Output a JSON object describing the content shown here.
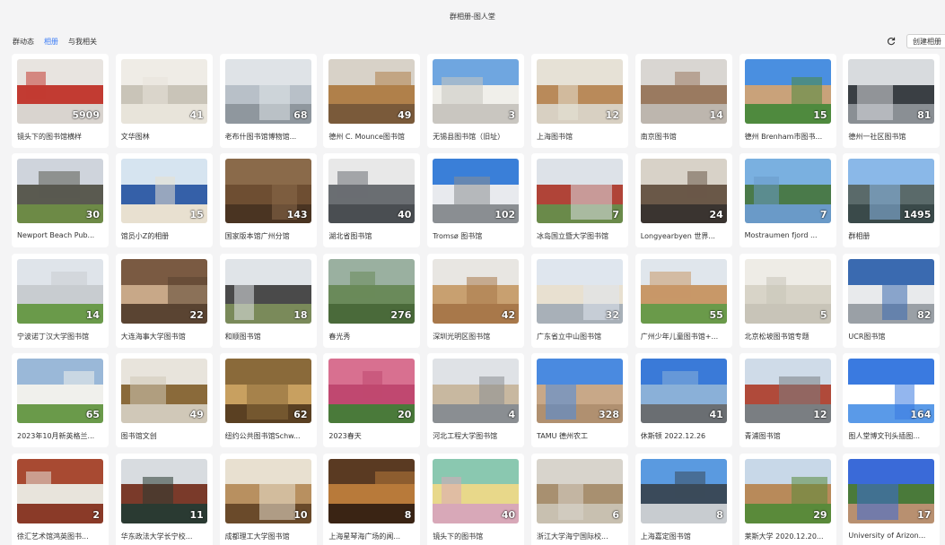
{
  "window": {
    "title": "群相册-图人堂"
  },
  "nav": {
    "tabs": [
      {
        "label": "群动态",
        "active": false
      },
      {
        "label": "相册",
        "active": true
      },
      {
        "label": "与我相关",
        "active": false
      }
    ],
    "create_label": "创建相册",
    "accent": "#3b7cf5"
  },
  "albums": [
    {
      "name": "镜头下的图书馆横样",
      "count": "5909",
      "c": [
        "#e8e4e0",
        "#c23b32",
        "#d9d4cf"
      ]
    },
    {
      "name": "文华图林",
      "count": "41",
      "c": [
        "#efece6",
        "#c9c4b8",
        "#e8e4da"
      ]
    },
    {
      "name": "老布什图书馆博物馆...",
      "count": "68",
      "c": [
        "#dfe3e7",
        "#b8c0c8",
        "#8f979e"
      ]
    },
    {
      "name": "德州 C. Mounce图书馆",
      "count": "49",
      "c": [
        "#d8d2c8",
        "#b0804a",
        "#7a5a3a"
      ]
    },
    {
      "name": "无锡县图书馆（旧址）",
      "count": "3",
      "c": [
        "#6fa6e0",
        "#f0efea",
        "#c9c6c0"
      ]
    },
    {
      "name": "上海图书馆",
      "count": "12",
      "c": [
        "#e6e1d6",
        "#b98a5a",
        "#d8d0c2"
      ]
    },
    {
      "name": "南京图书馆",
      "count": "14",
      "c": [
        "#d9d6d2",
        "#9a7a60",
        "#bdb6ae"
      ]
    },
    {
      "name": "德州 Brenham市图书...",
      "count": "15",
      "c": [
        "#4a8fe0",
        "#c9a27a",
        "#4f8a3e"
      ]
    },
    {
      "name": "德州一社区图书馆",
      "count": "81",
      "c": [
        "#d8dbde",
        "#3a3f44",
        "#8a8f94"
      ]
    },
    {
      "name": "Newport Beach Pub...",
      "count": "30",
      "c": [
        "#cfd4dc",
        "#5a5a50",
        "#6d8a46"
      ]
    },
    {
      "name": "馆员小Z的相册",
      "count": "15",
      "c": [
        "#d6e4f0",
        "#3560a8",
        "#e8e0d0"
      ]
    },
    {
      "name": "国家版本馆广州分馆",
      "count": "143",
      "c": [
        "#8a6a4a",
        "#6e4e32",
        "#4a3422"
      ]
    },
    {
      "name": "湖北省图书馆",
      "count": "40",
      "c": [
        "#e8e8e8",
        "#6a6e72",
        "#4a4e52"
      ]
    },
    {
      "name": "Tromsø 图书馆",
      "count": "102",
      "c": [
        "#3a7fd8",
        "#e8eaee",
        "#8a8e92"
      ]
    },
    {
      "name": "冰岛国立暨大学图书馆",
      "count": "7",
      "c": [
        "#dde2e8",
        "#b04438",
        "#6a8a4a"
      ]
    },
    {
      "name": "Longyearbyen 世界...",
      "count": "24",
      "c": [
        "#d8d2c8",
        "#6a5848",
        "#3a3430"
      ]
    },
    {
      "name": "Mostraumen fjord ...",
      "count": "7",
      "c": [
        "#7ab0e0",
        "#4a7a4a",
        "#6a9ac8"
      ]
    },
    {
      "name": "群相册",
      "count": "1495",
      "c": [
        "#8ab8e8",
        "#5a6a6a",
        "#3a4a4a"
      ]
    },
    {
      "name": "宁波诺丁汉大学图书馆",
      "count": "14",
      "c": [
        "#dfe4ea",
        "#c8ccd0",
        "#6a9a4a"
      ]
    },
    {
      "name": "大连海事大学图书馆",
      "count": "22",
      "c": [
        "#7a5a42",
        "#c8a888",
        "#5a4432"
      ]
    },
    {
      "name": "和顺图书馆",
      "count": "18",
      "c": [
        "#e0e4e8",
        "#4a4a4a",
        "#7a8a5a"
      ]
    },
    {
      "name": "春光秀",
      "count": "276",
      "c": [
        "#9ab0a0",
        "#6a8a5a",
        "#4a6a3a"
      ]
    },
    {
      "name": "深圳光明区图书馆",
      "count": "42",
      "c": [
        "#e8e6e2",
        "#c8a070",
        "#a8784a"
      ]
    },
    {
      "name": "广东省立中山图书馆",
      "count": "32",
      "c": [
        "#dfe6ee",
        "#e8e0d0",
        "#a8b0b8"
      ]
    },
    {
      "name": "广州少年儿童图书馆+...",
      "count": "55",
      "c": [
        "#e0e6ec",
        "#c89868",
        "#6a9a4a"
      ]
    },
    {
      "name": "北京松坡图书馆专题",
      "count": "5",
      "c": [
        "#eeece6",
        "#d8d4c8",
        "#c8c4b8"
      ]
    },
    {
      "name": "UCR图书馆",
      "count": "82",
      "c": [
        "#3a6ab0",
        "#e8eaec",
        "#9aa0a6"
      ]
    },
    {
      "name": "2023年10月新英格兰...",
      "count": "65",
      "c": [
        "#9ab8d8",
        "#f0f0ec",
        "#6a9a4a"
      ]
    },
    {
      "name": "图书馆文创",
      "count": "49",
      "c": [
        "#e8e4dc",
        "#8a6a3a",
        "#d0c8b8"
      ]
    },
    {
      "name": "纽约公共图书馆Schw...",
      "count": "62",
      "c": [
        "#8a6a3a",
        "#c8a060",
        "#5a4022"
      ]
    },
    {
      "name": "2023春天",
      "count": "20",
      "c": [
        "#d87090",
        "#c04870",
        "#4a7a3a"
      ]
    },
    {
      "name": "河北工程大学图书馆",
      "count": "4",
      "c": [
        "#dfe2e6",
        "#c8b8a0",
        "#8a8e92"
      ]
    },
    {
      "name": "TAMU 德州农工",
      "count": "328",
      "c": [
        "#4a8ae0",
        "#c8a888",
        "#b09070"
      ]
    },
    {
      "name": "休斯顿 2022.12.26",
      "count": "41",
      "c": [
        "#3a7ad8",
        "#8ab0d8",
        "#6a6e72"
      ]
    },
    {
      "name": "青浦图书馆",
      "count": "12",
      "c": [
        "#cfdbe8",
        "#b04a3a",
        "#7a7e82"
      ]
    },
    {
      "name": "图人堂博文刊头插图...",
      "count": "164",
      "c": [
        "#3a7ae0",
        "#ffffff",
        "#5a9ae8"
      ]
    },
    {
      "name": "徐汇艺术馆鸿英图书...",
      "count": "2",
      "c": [
        "#a84a32",
        "#e8e4dc",
        "#8a3a28"
      ]
    },
    {
      "name": "华东政法大学长宁校...",
      "count": "11",
      "c": [
        "#d8dce0",
        "#7a3a2a",
        "#2a3a32"
      ]
    },
    {
      "name": "成都理工大学图书馆",
      "count": "10",
      "c": [
        "#e8e0d0",
        "#b89060",
        "#6a4a2a"
      ]
    },
    {
      "name": "上海星琴海广场的闻...",
      "count": "8",
      "c": [
        "#5a3a22",
        "#b87a3a",
        "#3a2414"
      ]
    },
    {
      "name": "镜头下的图书馆",
      "count": "40",
      "c": [
        "#8ac8b0",
        "#e8d88a",
        "#d8a8b8"
      ]
    },
    {
      "name": "浙江大学海宁国际校...",
      "count": "6",
      "c": [
        "#d8d4cc",
        "#a89070",
        "#c8c0b0"
      ]
    },
    {
      "name": "上海嘉定图书馆",
      "count": "8",
      "c": [
        "#5a9ae0",
        "#3a4a5a",
        "#c8ccd0"
      ]
    },
    {
      "name": "莱斯大学 2020.12.20...",
      "count": "29",
      "c": [
        "#c8d8e8",
        "#b88a5a",
        "#5a8a3a"
      ]
    },
    {
      "name": "University of Arizon...",
      "count": "17",
      "c": [
        "#3a6ad8",
        "#4a7a3a",
        "#b89070"
      ]
    }
  ]
}
